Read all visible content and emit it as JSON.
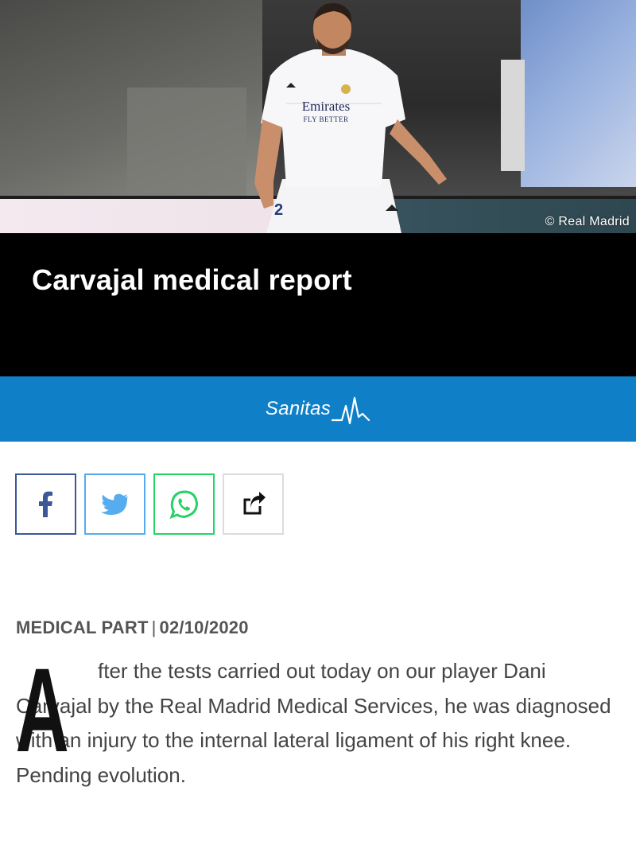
{
  "hero": {
    "photo_credit": "© Real Madrid",
    "shirt_sponsor_line1": "Emirates",
    "shirt_sponsor_line2": "FLY BETTER"
  },
  "article": {
    "title": "Carvajal medical report",
    "sponsor": {
      "name": "Sanitas"
    },
    "share": {
      "icons": [
        "facebook-icon",
        "twitter-icon",
        "whatsapp-icon",
        "share-icon"
      ]
    },
    "category": "MEDICAL PART",
    "separator": "|",
    "date": "02/10/2020",
    "dropcap": "A",
    "body": "fter the tests carried out today on our player Dani Carvajal by the Real Madrid Medical Services, he was diagnosed with an injury to the internal lateral ligament of his right knee. Pending evolution."
  },
  "colors": {
    "title_bar": "#000000",
    "sponsor_bar": "#0f80c8",
    "facebook": "#3b5998",
    "twitter": "#55acee",
    "whatsapp": "#25d366"
  }
}
